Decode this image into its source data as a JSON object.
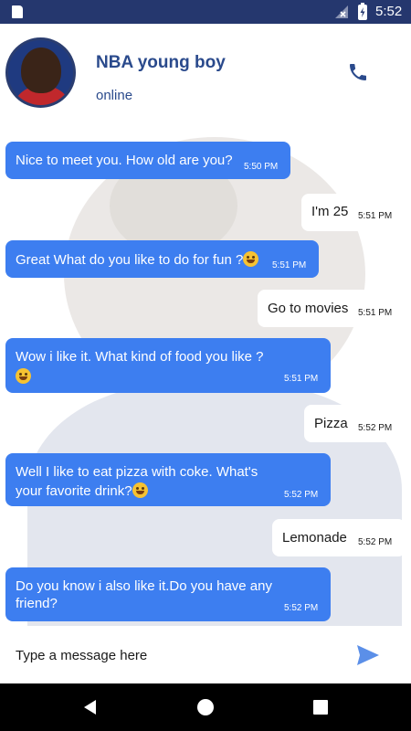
{
  "status_bar": {
    "time": "5:52",
    "icons": [
      "sd-card-icon",
      "no-signal-icon",
      "battery-charging-icon"
    ]
  },
  "header": {
    "name": "NBA young boy",
    "status": "online",
    "call_icon": "phone-icon"
  },
  "colors": {
    "status_bar": "#25376e",
    "header_text": "#2a4a8c",
    "incoming_bubble": "#3d7ef0",
    "outgoing_bubble": "#ffffff",
    "send_icon": "#5b8fe8"
  },
  "messages": [
    {
      "direction": "in",
      "text": "Nice to meet you. How old are you?",
      "time": "5:50 PM"
    },
    {
      "direction": "out",
      "text": "I'm 25",
      "time": "5:51 PM"
    },
    {
      "direction": "in",
      "text": "Great What do you like to do for fun ?",
      "emoji": "grinning-sweat-emoji",
      "time": "5:51 PM"
    },
    {
      "direction": "out",
      "text": "Go to movies",
      "time": "5:51 PM"
    },
    {
      "direction": "in",
      "text": "Wow i like it. What kind of food you like ?",
      "emoji": "drooling-emoji",
      "time": "5:51 PM"
    },
    {
      "direction": "out",
      "text": "Pizza",
      "time": "5:52 PM"
    },
    {
      "direction": "in",
      "text_line1": "Well I like to eat pizza with coke. What's",
      "text_line2": "your favorite drink?",
      "emoji": "drooling-emoji",
      "time": "5:52 PM"
    },
    {
      "direction": "out",
      "text": "Lemonade",
      "time": "5:52 PM"
    },
    {
      "direction": "in",
      "text_line1": "Do you know i also like it.Do you have any",
      "text_line2": "friend?",
      "time": "5:52 PM"
    }
  ],
  "composer": {
    "placeholder": "Type a message here",
    "send_icon": "send-icon"
  },
  "nav_bar": {
    "icons": [
      "back-icon",
      "home-icon",
      "recents-icon"
    ]
  }
}
